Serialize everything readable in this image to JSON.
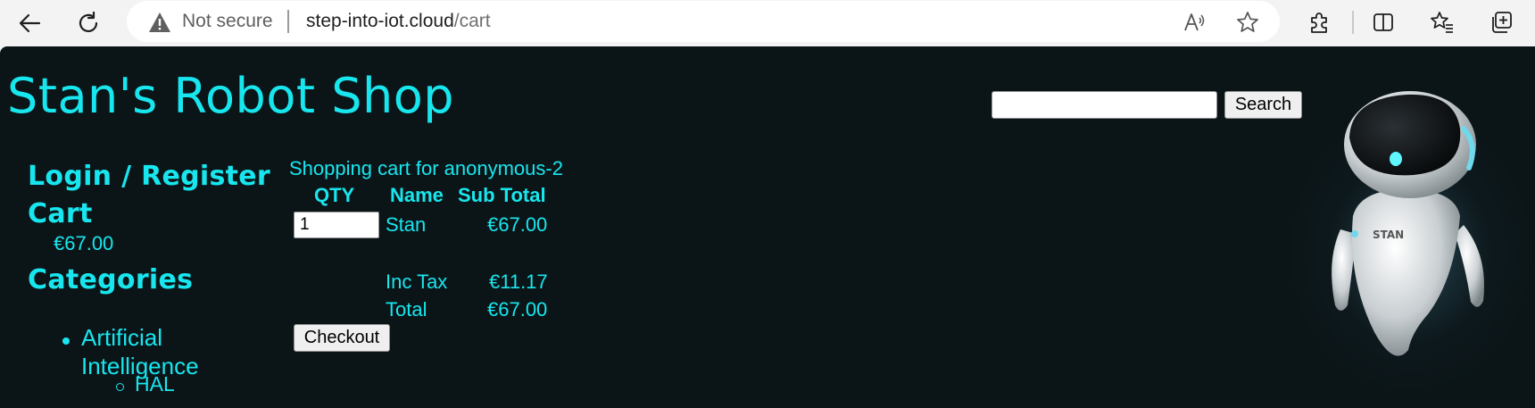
{
  "browser": {
    "security_text": "Not secure",
    "url_host": "step-into-iot.cloud",
    "url_path": "/cart",
    "icons": [
      "back-icon",
      "refresh-icon",
      "warning-icon",
      "read-aloud-icon",
      "favorite-star-icon",
      "extensions-icon",
      "split-screen-icon",
      "favorites-icon",
      "collections-icon"
    ]
  },
  "site": {
    "title": "Stan's Robot Shop",
    "accent_color": "#18e6ee",
    "background_color": "#0b1518"
  },
  "search": {
    "value": "",
    "button_label": "Search"
  },
  "sidebar": {
    "login_label": "Login / Register",
    "cart_label": "Cart",
    "cart_total": "€67.00",
    "categories_label": "Categories",
    "categories": [
      {
        "label": "Artificial Intelligence",
        "items": [
          "HAL"
        ]
      }
    ]
  },
  "cart": {
    "title": "Shopping cart for anonymous-2",
    "headers": {
      "qty": "QTY",
      "name": "Name",
      "subtotal": "Sub Total"
    },
    "items": [
      {
        "qty": "1",
        "name": "Stan",
        "subtotal": "€67.00"
      }
    ],
    "tax_label": "Inc Tax",
    "tax_value": "€11.17",
    "total_label": "Total",
    "total_value": "€67.00",
    "checkout_label": "Checkout"
  },
  "robot": {
    "badge_text": "STAN"
  }
}
